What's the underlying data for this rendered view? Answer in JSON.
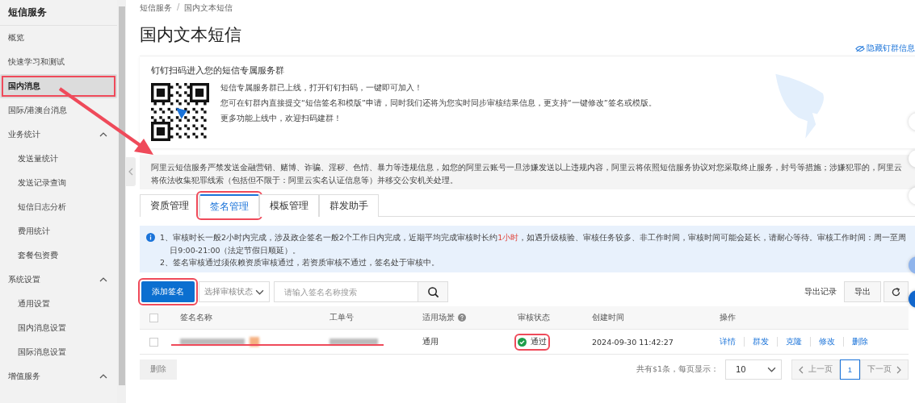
{
  "sidebar": {
    "title": "短信服务",
    "items": [
      {
        "label": "概览",
        "selected": false
      },
      {
        "label": "快速学习和测试",
        "selected": false
      },
      {
        "label": "国内消息",
        "selected": true
      },
      {
        "label": "国际/港澳台消息",
        "selected": false
      },
      {
        "label": "业务统计",
        "selected": false,
        "expanded": true,
        "children": [
          {
            "label": "发送量统计",
            "selected": false
          },
          {
            "label": "发送记录查询",
            "selected": false
          },
          {
            "label": "短信日志分析",
            "selected": false
          },
          {
            "label": "费用统计",
            "selected": false
          },
          {
            "label": "套餐包资费",
            "selected": false
          }
        ]
      },
      {
        "label": "系统设置",
        "selected": false,
        "expanded": true,
        "children": [
          {
            "label": "通用设置",
            "selected": false
          },
          {
            "label": "国内消息设置",
            "selected": false
          },
          {
            "label": "国际消息设置",
            "selected": false
          }
        ]
      },
      {
        "label": "增值服务",
        "selected": false,
        "expanded": true
      }
    ]
  },
  "breadcrumb": [
    "短信服务",
    "国内文本短信"
  ],
  "breadcrumb_separator": "/",
  "page_title": "国内文本短信",
  "hide_link": "隐藏钉群信息",
  "group_card": {
    "title": "钉钉扫码进入您的短信专属服务群",
    "lines": [
      "短信专属服务群已上线，打开钉钉扫码，一键即可加入！",
      "您可在钉群内直接提交“短信签名和模版”申请，同时我们还将为您实时同步审核结果信息，更支持“一键修改”签名或模版。",
      "更多功能上线中，欢迎扫码建群！"
    ]
  },
  "warning": "阿里云短信服务严禁发送金融营销、赌博、诈骗、淫秽、色情、暴力等违规信息，如您的阿里云账号一旦涉嫌发送以上违规内容，阿里云将依照短信服务协议对您采取终止服务，封号等措施；涉嫌犯罪的，阿里云将依法收集犯罪线索（包括但不限于：阿里云实名认证信息等）并移交公安机关处理。",
  "tabs": [
    {
      "label": "资质管理",
      "selected": false
    },
    {
      "label": "签名管理",
      "selected": true
    },
    {
      "label": "模板管理",
      "selected": false
    },
    {
      "label": "群发助手",
      "selected": false
    }
  ],
  "notice": [
    {
      "before": "1、审核时长一般2小时内完成，涉及政企签名一般2个工作日内完成，近期平均完成审核时长约",
      "highlight": "1小时",
      "after": "，如遇升级核验、审核任务较多、非工作时间，审核时间可能会延长，请耐心等待。审核工作时间：周一至周日9:00-21:00（法定节假日顺延）。"
    },
    {
      "before": "2、签名审核通过须依赖资质审核通过，若资质审核不通过，签名处于审核中。"
    }
  ],
  "toolbar": {
    "add_button": "添加签名",
    "status_select": {
      "placeholder": "选择审核状态"
    },
    "search": {
      "placeholder": "请输入签名名称搜索"
    },
    "export_records": "导出记录",
    "export_button": "导出"
  },
  "table": {
    "header_checked": false,
    "columns": [
      "签名名称",
      "工单号",
      "适用场景",
      "审核状态",
      "创建时间",
      "操作"
    ],
    "rows": [
      {
        "checked": false,
        "scene": "通用",
        "status": {
          "label": "通过",
          "kind": "approved"
        },
        "created": "2024-09-30 11:42:27",
        "actions": [
          "详情",
          "群发",
          "克隆",
          "修改",
          "删除"
        ]
      }
    ]
  },
  "footer": {
    "delete_button": {
      "label": "删除",
      "disabled": true
    },
    "total": "共有$1条，每页显示：",
    "page_size": "10",
    "prev": {
      "label": "上一页",
      "disabled": true
    },
    "pages": [
      {
        "label": "1",
        "selected": true
      }
    ],
    "next": {
      "label": "下一页",
      "disabled": true
    }
  }
}
